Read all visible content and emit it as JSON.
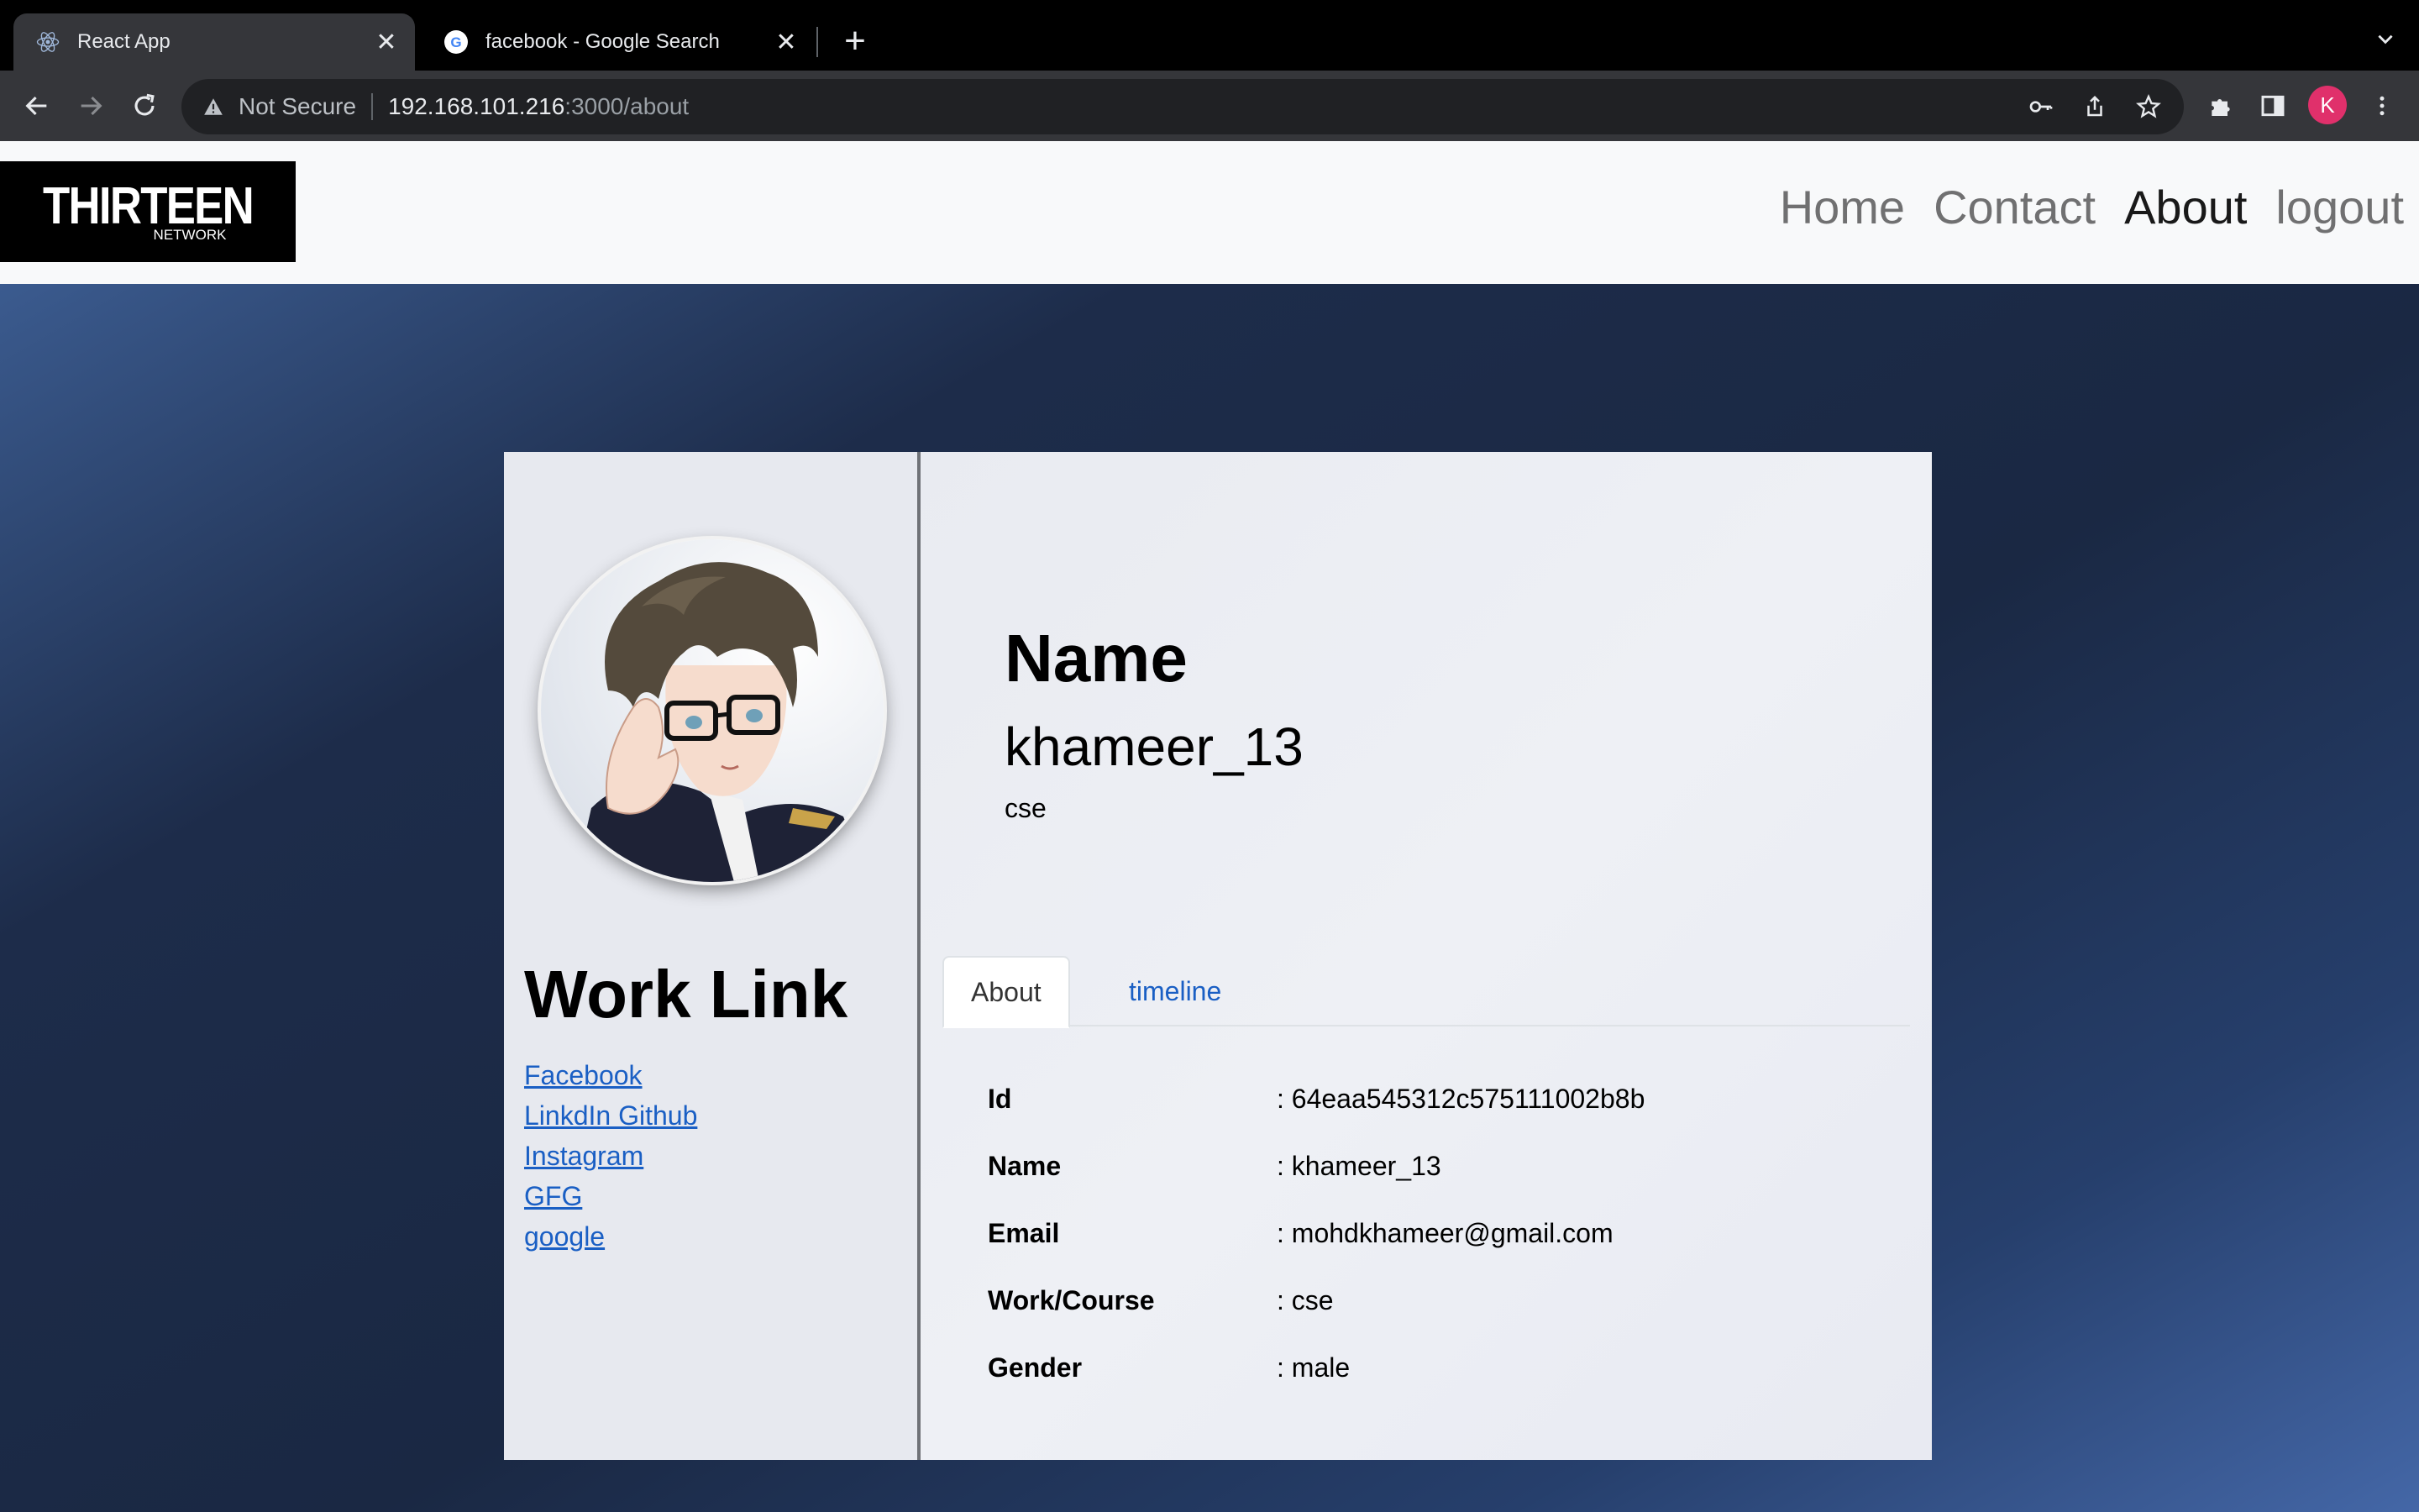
{
  "browser": {
    "tabs": [
      {
        "title": "React App",
        "icon": "react-icon",
        "active": true
      },
      {
        "title": "facebook - Google Search",
        "icon": "google-icon",
        "active": false
      }
    ],
    "address": {
      "security": "Not Secure",
      "host": "192.168.101.216",
      "path": ":3000/about"
    },
    "profile_initial": "K"
  },
  "navbar": {
    "logo_main": "THIRTEEN",
    "logo_sub": "NETWORK",
    "links": [
      "Home",
      "Contact",
      "About",
      "logout"
    ],
    "active": "About"
  },
  "profile": {
    "worklink_title": "Work Link",
    "worklinks": [
      "Facebook",
      "LinkdIn Github",
      "Instagram",
      "GFG",
      "google"
    ],
    "name_label": "Name",
    "name_value": "khameer_13",
    "work_value": "cse",
    "tabs": [
      "About",
      "timeline"
    ],
    "details": [
      {
        "key": "Id",
        "value": ": 64eaa545312c575111002b8b"
      },
      {
        "key": "Name",
        "value": ": khameer_13"
      },
      {
        "key": "Email",
        "value": ": mohdkhameer@gmail.com"
      },
      {
        "key": "Work/Course",
        "value": ": cse"
      },
      {
        "key": "Gender",
        "value": ": male"
      }
    ]
  },
  "colors": {
    "link": "#1a5fc4",
    "chrome_bg": "#35363a",
    "profile_badge": "#e0306b"
  }
}
